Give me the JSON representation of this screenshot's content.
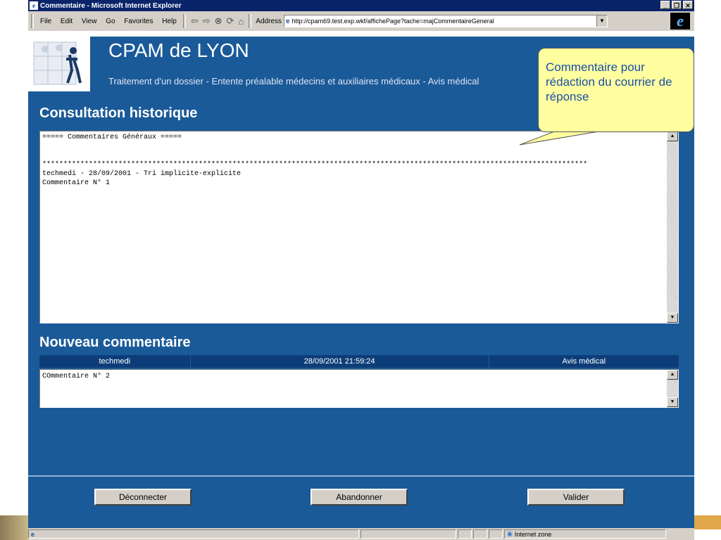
{
  "window": {
    "title": "Commentaire - Microsoft Internet Explorer",
    "minimize": "_",
    "maximize": "❐",
    "close": "✕"
  },
  "menu": [
    "File",
    "Edit",
    "View",
    "Go",
    "Favorites",
    "Help"
  ],
  "address": {
    "label": "Address",
    "url": "http://cpam69.test.exp.wkf/affichePage?tache=majCommentaireGeneral"
  },
  "header": {
    "title": "CPAM de LYON",
    "subtitle": "Traitement d'un dossier - Entente préalable médecins et auxiliaires médicaux - Avis médical"
  },
  "historique": {
    "title": "Consultation historique",
    "text": "===== Commentaires Généraux =====\n\n\n*********************************************************************************************************************************\ntechmedi - 28/09/2001 - Tri implicite-explicite\nCommentaire N° 1"
  },
  "nouveau": {
    "title": "Nouveau commentaire",
    "user": "techmedi",
    "datetime": "28/09/2001 21:59:24",
    "type": "Avis médical",
    "text": "COmmentaire N° 2"
  },
  "buttons": {
    "deconnecter": "Déconnecter",
    "abandonner": "Abandonner",
    "valider": "Valider"
  },
  "status": {
    "zone": "Internet zone"
  },
  "callout": {
    "text": "Commentaire pour rédaction du courrier de réponse"
  },
  "colors": {
    "page_bg": "#1b5a98",
    "header_row": "#0d3d78",
    "callout_bg": "#ffffa0",
    "callout_text": "#1a4ea8"
  }
}
